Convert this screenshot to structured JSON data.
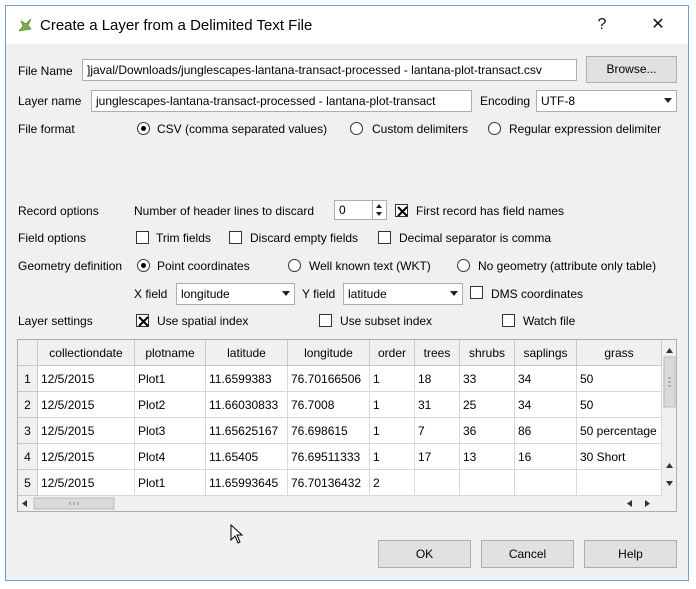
{
  "window": {
    "title": "Create a Layer from a Delimited Text File",
    "help_glyph": "?",
    "close_glyph": "✕"
  },
  "file": {
    "label": "File Name",
    "value": "]javal/Downloads/junglescapes-lantana-transact-processed - lantana-plot-transact.csv",
    "browse_label": "Browse..."
  },
  "layer": {
    "label": "Layer name",
    "value": "junglescapes-lantana-transact-processed - lantana-plot-transact",
    "encoding_label": "Encoding",
    "encoding_value": "UTF-8"
  },
  "format": {
    "label": "File format",
    "options": [
      "CSV (comma separated values)",
      "Custom delimiters",
      "Regular expression delimiter"
    ],
    "selected": 0
  },
  "record": {
    "label": "Record options",
    "header_lines_label": "Number of header lines to discard",
    "header_lines_value": "0",
    "first_record_label": "First record has field names",
    "first_record_checked": true
  },
  "field": {
    "label": "Field options",
    "trim_label": "Trim fields",
    "discard_label": "Discard empty fields",
    "decimal_label": "Decimal separator is comma"
  },
  "geometry": {
    "label": "Geometry definition",
    "options": [
      "Point coordinates",
      "Well known text (WKT)",
      "No geometry (attribute only table)"
    ],
    "selected": 0,
    "x_label": "X field",
    "x_value": "longitude",
    "y_label": "Y field",
    "y_value": "latitude",
    "dms_label": "DMS coordinates"
  },
  "settings": {
    "label": "Layer settings",
    "spatial_label": "Use spatial index",
    "spatial_checked": true,
    "subset_label": "Use subset index",
    "watch_label": "Watch file"
  },
  "table": {
    "columns": [
      "collectiondate",
      "plotname",
      "latitude",
      "longitude",
      "order",
      "trees",
      "shrubs",
      "saplings",
      "grass"
    ],
    "rows": [
      [
        "12/5/2015",
        "Plot1",
        "11.6599383",
        "76.70166506",
        "1",
        "18",
        "33",
        "34",
        "50"
      ],
      [
        "12/5/2015",
        "Plot2",
        "11.66030833",
        "76.7008",
        "1",
        "31",
        "25",
        "34",
        "50"
      ],
      [
        "12/5/2015",
        "Plot3",
        "11.65625167",
        "76.698615",
        "1",
        "7",
        "36",
        "86",
        "50 percentage"
      ],
      [
        "12/5/2015",
        "Plot4",
        "11.65405",
        "76.69511333",
        "1",
        "17",
        "13",
        "16",
        "30 Short"
      ],
      [
        "12/5/2015",
        "Plot1",
        "11.65993645",
        "76.70136432",
        "2",
        "",
        "",
        "",
        ""
      ]
    ],
    "row_numbers": [
      "1",
      "2",
      "3",
      "4",
      "5"
    ]
  },
  "buttons": {
    "ok": "OK",
    "cancel": "Cancel",
    "help": "Help"
  }
}
